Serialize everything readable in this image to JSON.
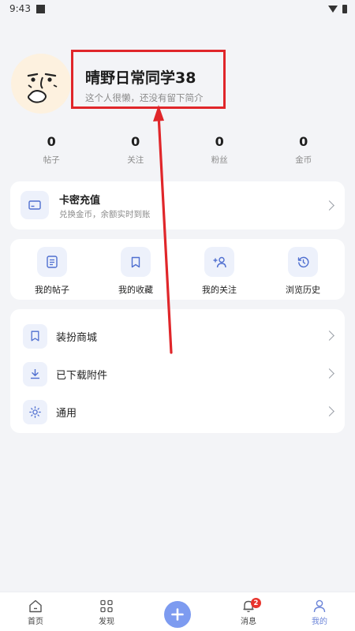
{
  "status_bar": {
    "time": "9:43"
  },
  "profile": {
    "name": "晴野日常同学38",
    "bio": "这个人很懒，还没有留下简介"
  },
  "stats": [
    {
      "value": "0",
      "label": "帖子"
    },
    {
      "value": "0",
      "label": "关注"
    },
    {
      "value": "0",
      "label": "粉丝"
    },
    {
      "value": "0",
      "label": "金币"
    }
  ],
  "recharge": {
    "title": "卡密充值",
    "subtitle": "兑换金币，余额实时到账",
    "icon": "card-icon"
  },
  "quick_actions": [
    {
      "label": "我的帖子",
      "icon": "posts-icon"
    },
    {
      "label": "我的收藏",
      "icon": "bookmark-icon"
    },
    {
      "label": "我的关注",
      "icon": "follow-user-icon"
    },
    {
      "label": "浏览历史",
      "icon": "history-icon"
    }
  ],
  "menu": [
    {
      "label": "装扮商城",
      "icon": "bookmark-icon"
    },
    {
      "label": "已下载附件",
      "icon": "download-icon"
    },
    {
      "label": "通用",
      "icon": "settings-sun-icon"
    }
  ],
  "bottom_nav": [
    {
      "label": "首页",
      "icon": "home-icon"
    },
    {
      "label": "发现",
      "icon": "discover-grid-icon"
    },
    {
      "label": "",
      "icon": "plus-icon"
    },
    {
      "label": "消息",
      "icon": "bell-icon",
      "badge": "2"
    },
    {
      "label": "我的",
      "icon": "person-icon",
      "active": true
    }
  ],
  "colors": {
    "accent": "#7d9bf0",
    "active_nav": "#6b84d8",
    "highlight": "#e0262a",
    "badge": "#e8342c",
    "background": "#f3f4f7",
    "icon_tile": "#edf1fb"
  }
}
